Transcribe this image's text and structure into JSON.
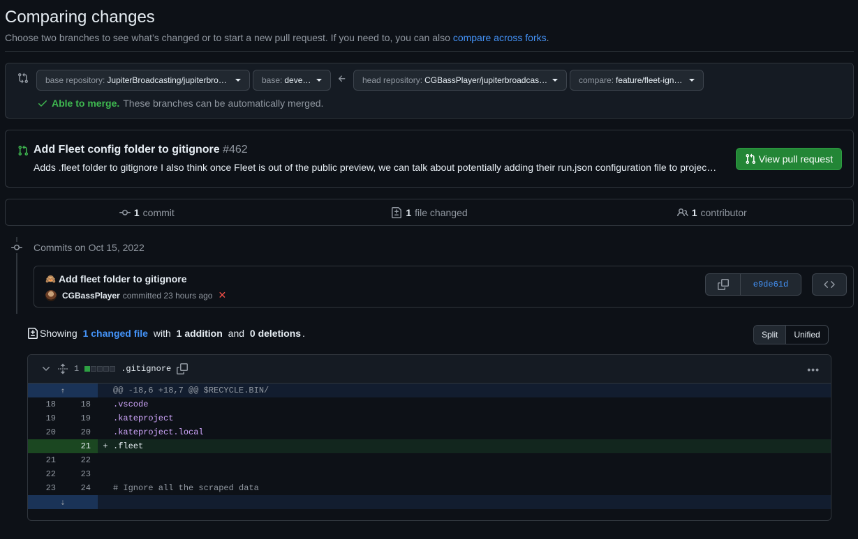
{
  "header": {
    "title": "Comparing changes",
    "subtitle": "Choose two branches to see what’s changed or to start a new pull request. If you need to, you can also",
    "forks_link": "compare across forks",
    "period": "."
  },
  "range": {
    "base_repo_label": "base repository:",
    "base_repo_value": "JupiterBroadcasting/jupiterbroa…",
    "base_label": "base:",
    "base_value": "develop",
    "head_repo_label": "head repository:",
    "head_repo_value": "CGBassPlayer/jupiterbroadcast…",
    "compare_label": "compare:",
    "compare_value": "feature/fleet-ignore",
    "merge_ok": "Able to merge.",
    "merge_text": "These branches can be automatically merged."
  },
  "pr": {
    "title": "Add Fleet config folder to gitignore",
    "number": "#462",
    "description": "Adds .fleet folder to gitignore I also think once Fleet is out of the public preview, we can talk about potentially adding their run.json configuration file to projec…",
    "button_label": "View pull request"
  },
  "stats": {
    "commits_count": "1",
    "commits_label": "commit",
    "files_count": "1",
    "files_label": "file changed",
    "contributors_count": "1",
    "contributors_label": "contributor"
  },
  "commits": {
    "date_heading": "Commits on Oct 15, 2022",
    "message": "Add fleet folder to gitignore",
    "author": "CGBassPlayer",
    "committed_text": "committed 23 hours ago",
    "sha": "e9de61d"
  },
  "summary": {
    "showing": "Showing",
    "changed_files": "1 changed file",
    "with": "with",
    "additions": "1 addition",
    "and": "and",
    "deletions": "0 deletions",
    "period": "."
  },
  "view_toggle": {
    "split": "Split",
    "unified": "Unified"
  },
  "file": {
    "change_count": "1",
    "name": ".gitignore",
    "hunk_header": "@@ -18,6 +18,7 @@ $RECYCLE.BIN/",
    "lines": [
      {
        "old": "18",
        "new": "18",
        "sign": "",
        "code": ".vscode"
      },
      {
        "old": "19",
        "new": "19",
        "sign": "",
        "code": ".kateproject"
      },
      {
        "old": "20",
        "new": "20",
        "sign": "",
        "code": ".kateproject.local"
      },
      {
        "old": "",
        "new": "21",
        "sign": "+",
        "code": ".fleet"
      },
      {
        "old": "21",
        "new": "22",
        "sign": "",
        "code": ""
      },
      {
        "old": "22",
        "new": "23",
        "sign": "",
        "code": ""
      },
      {
        "old": "23",
        "new": "24",
        "sign": "",
        "code": "# Ignore all the scraped data"
      }
    ]
  }
}
